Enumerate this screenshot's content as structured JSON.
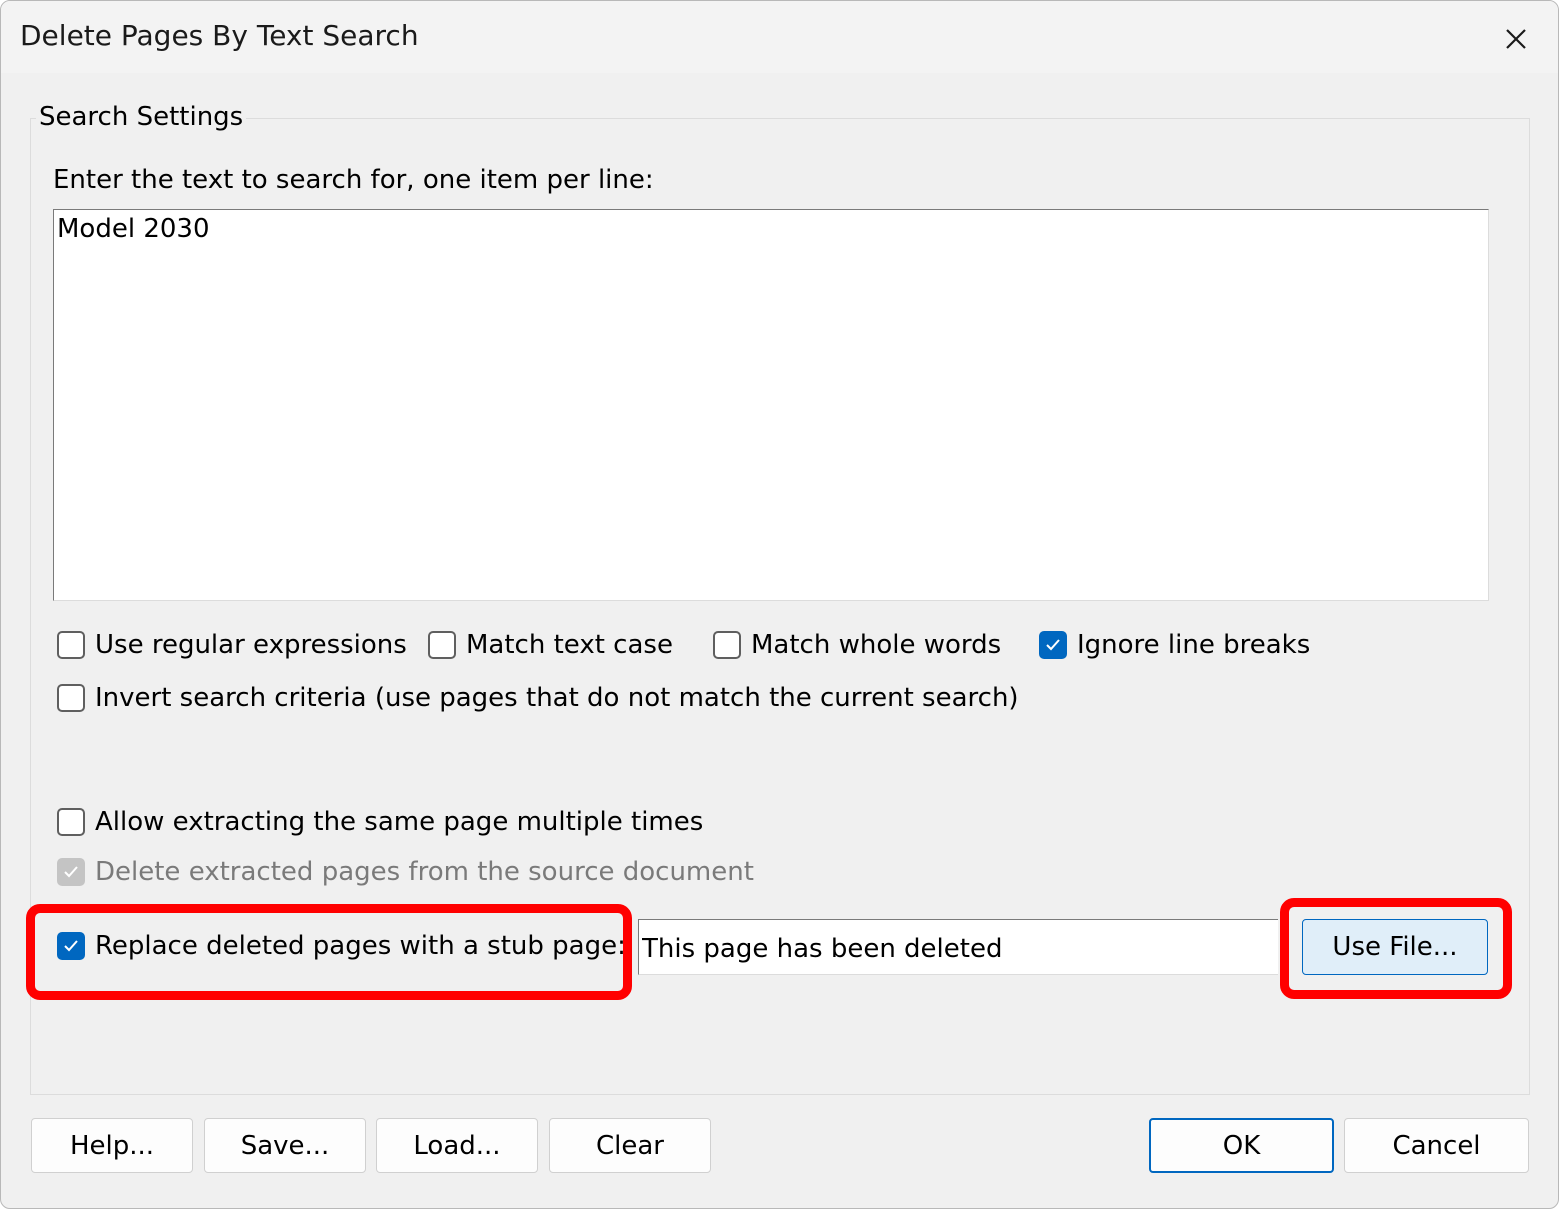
{
  "window": {
    "title": "Delete Pages By Text Search"
  },
  "group": {
    "title": "Search Settings",
    "search_label": "Enter the text to search for, one item per line:",
    "search_text": "Model 2030"
  },
  "options": {
    "regex": {
      "label": "Use regular expressions",
      "checked": false
    },
    "match_case": {
      "label": "Match text case",
      "checked": false
    },
    "whole_words": {
      "label": "Match whole words",
      "checked": false
    },
    "ignore_breaks": {
      "label": "Ignore line breaks",
      "checked": true
    },
    "invert": {
      "label": "Invert search criteria (use pages that do not match the current search)",
      "checked": false
    },
    "allow_multi": {
      "label": "Allow extracting the same page multiple times",
      "checked": false
    },
    "delete_source": {
      "label": "Delete extracted pages from the source document",
      "checked": true,
      "disabled": true
    },
    "replace_stub": {
      "label": "Replace deleted pages with a stub page:",
      "checked": true
    }
  },
  "stub": {
    "text": "This page has been deleted",
    "use_file_label": "Use File..."
  },
  "buttons": {
    "help": "Help...",
    "save": "Save...",
    "load": "Load...",
    "clear": "Clear",
    "ok": "OK",
    "cancel": "Cancel"
  },
  "colors": {
    "accent": "#0067c0",
    "highlight": "#ff0000"
  }
}
